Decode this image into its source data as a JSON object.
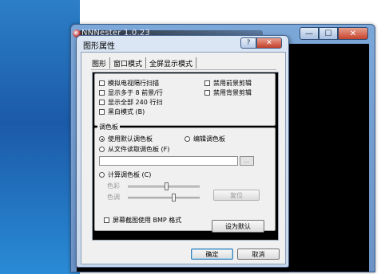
{
  "main_window": {
    "title": "NNNester 1.0.23",
    "controls": {
      "minimize": "—",
      "maximize": "☐",
      "close": "✕"
    }
  },
  "dialog": {
    "title": "图形属性",
    "help_glyph": "?",
    "close_glyph": "✕",
    "tabs": [
      {
        "label": "图形",
        "active": true
      },
      {
        "label": "窗口模式",
        "active": false
      },
      {
        "label": "全屏显示模式",
        "active": false
      }
    ],
    "checkboxes": [
      {
        "label": "模拟电视隔行扫描",
        "checked": false
      },
      {
        "label": "显示多于 8 前景/行",
        "checked": false
      },
      {
        "label": "显示全部 240 行扫",
        "checked": false
      },
      {
        "label": "黑白模式 (B)",
        "checked": false
      },
      {
        "label": "禁用前景剪辑",
        "checked": false
      },
      {
        "label": "禁用背景剪辑",
        "checked": false
      }
    ],
    "palette_group": {
      "label": "调色板",
      "radios": [
        {
          "label": "使用默认调色板",
          "selected": true
        },
        {
          "label": "编辑调色板",
          "selected": false
        },
        {
          "label": "从文件读取调色板 (F)",
          "selected": false
        },
        {
          "label": "计算调色板 (C)",
          "selected": false
        }
      ],
      "file_path": "",
      "browse_label": "...",
      "saturation_label": "色彩",
      "hue_label": "色调",
      "reset_label": "复位"
    },
    "screenshot_bmp": {
      "label": "屏幕截图使用 BMP 格式",
      "checked": false
    },
    "set_default_label": "设为默认",
    "ok_label": "确定",
    "cancel_label": "取消"
  }
}
